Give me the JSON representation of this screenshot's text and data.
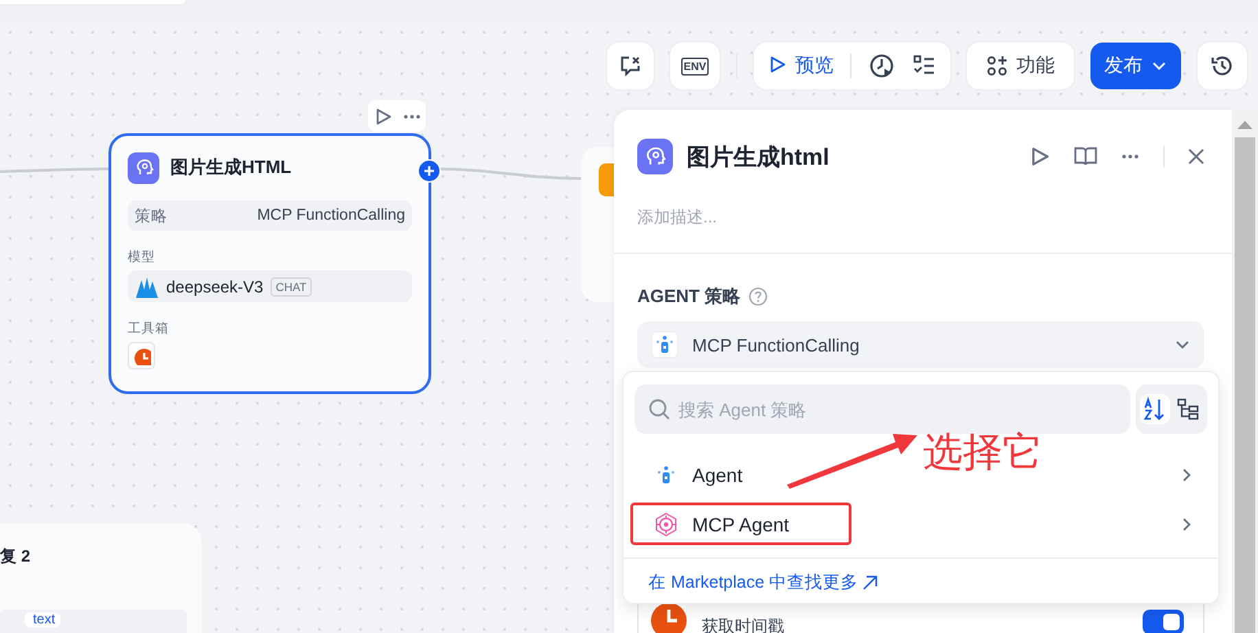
{
  "toolbar": {
    "env_label": "ENV",
    "preview_label": "预览",
    "features_label": "功能",
    "publish_label": "发布"
  },
  "node": {
    "title": "图片生成HTML",
    "selected": true,
    "strategy_label": "策略",
    "strategy_value": "MCP FunctionCalling",
    "model_label": "模型",
    "model_name": "deepseek-V3",
    "model_badge": "CHAT",
    "tools_label": "工具箱"
  },
  "partial_node": {
    "title": "复 2",
    "variable": "text"
  },
  "panel": {
    "title": "图片生成html",
    "description_placeholder": "添加描述...",
    "section_label": "AGENT 策略",
    "select_value": "MCP FunctionCalling",
    "tool": {
      "name": "获取时间戳",
      "enabled": true
    }
  },
  "dropdown": {
    "search_placeholder": "搜索 Agent 策略",
    "options": [
      {
        "label": "Agent",
        "kind": "agent",
        "highlighted": false
      },
      {
        "label": "MCP Agent",
        "kind": "mcp",
        "highlighted": true
      }
    ],
    "marketplace_link": "在 Marketplace 中查找更多"
  },
  "annotation": {
    "text": "选择它"
  }
}
